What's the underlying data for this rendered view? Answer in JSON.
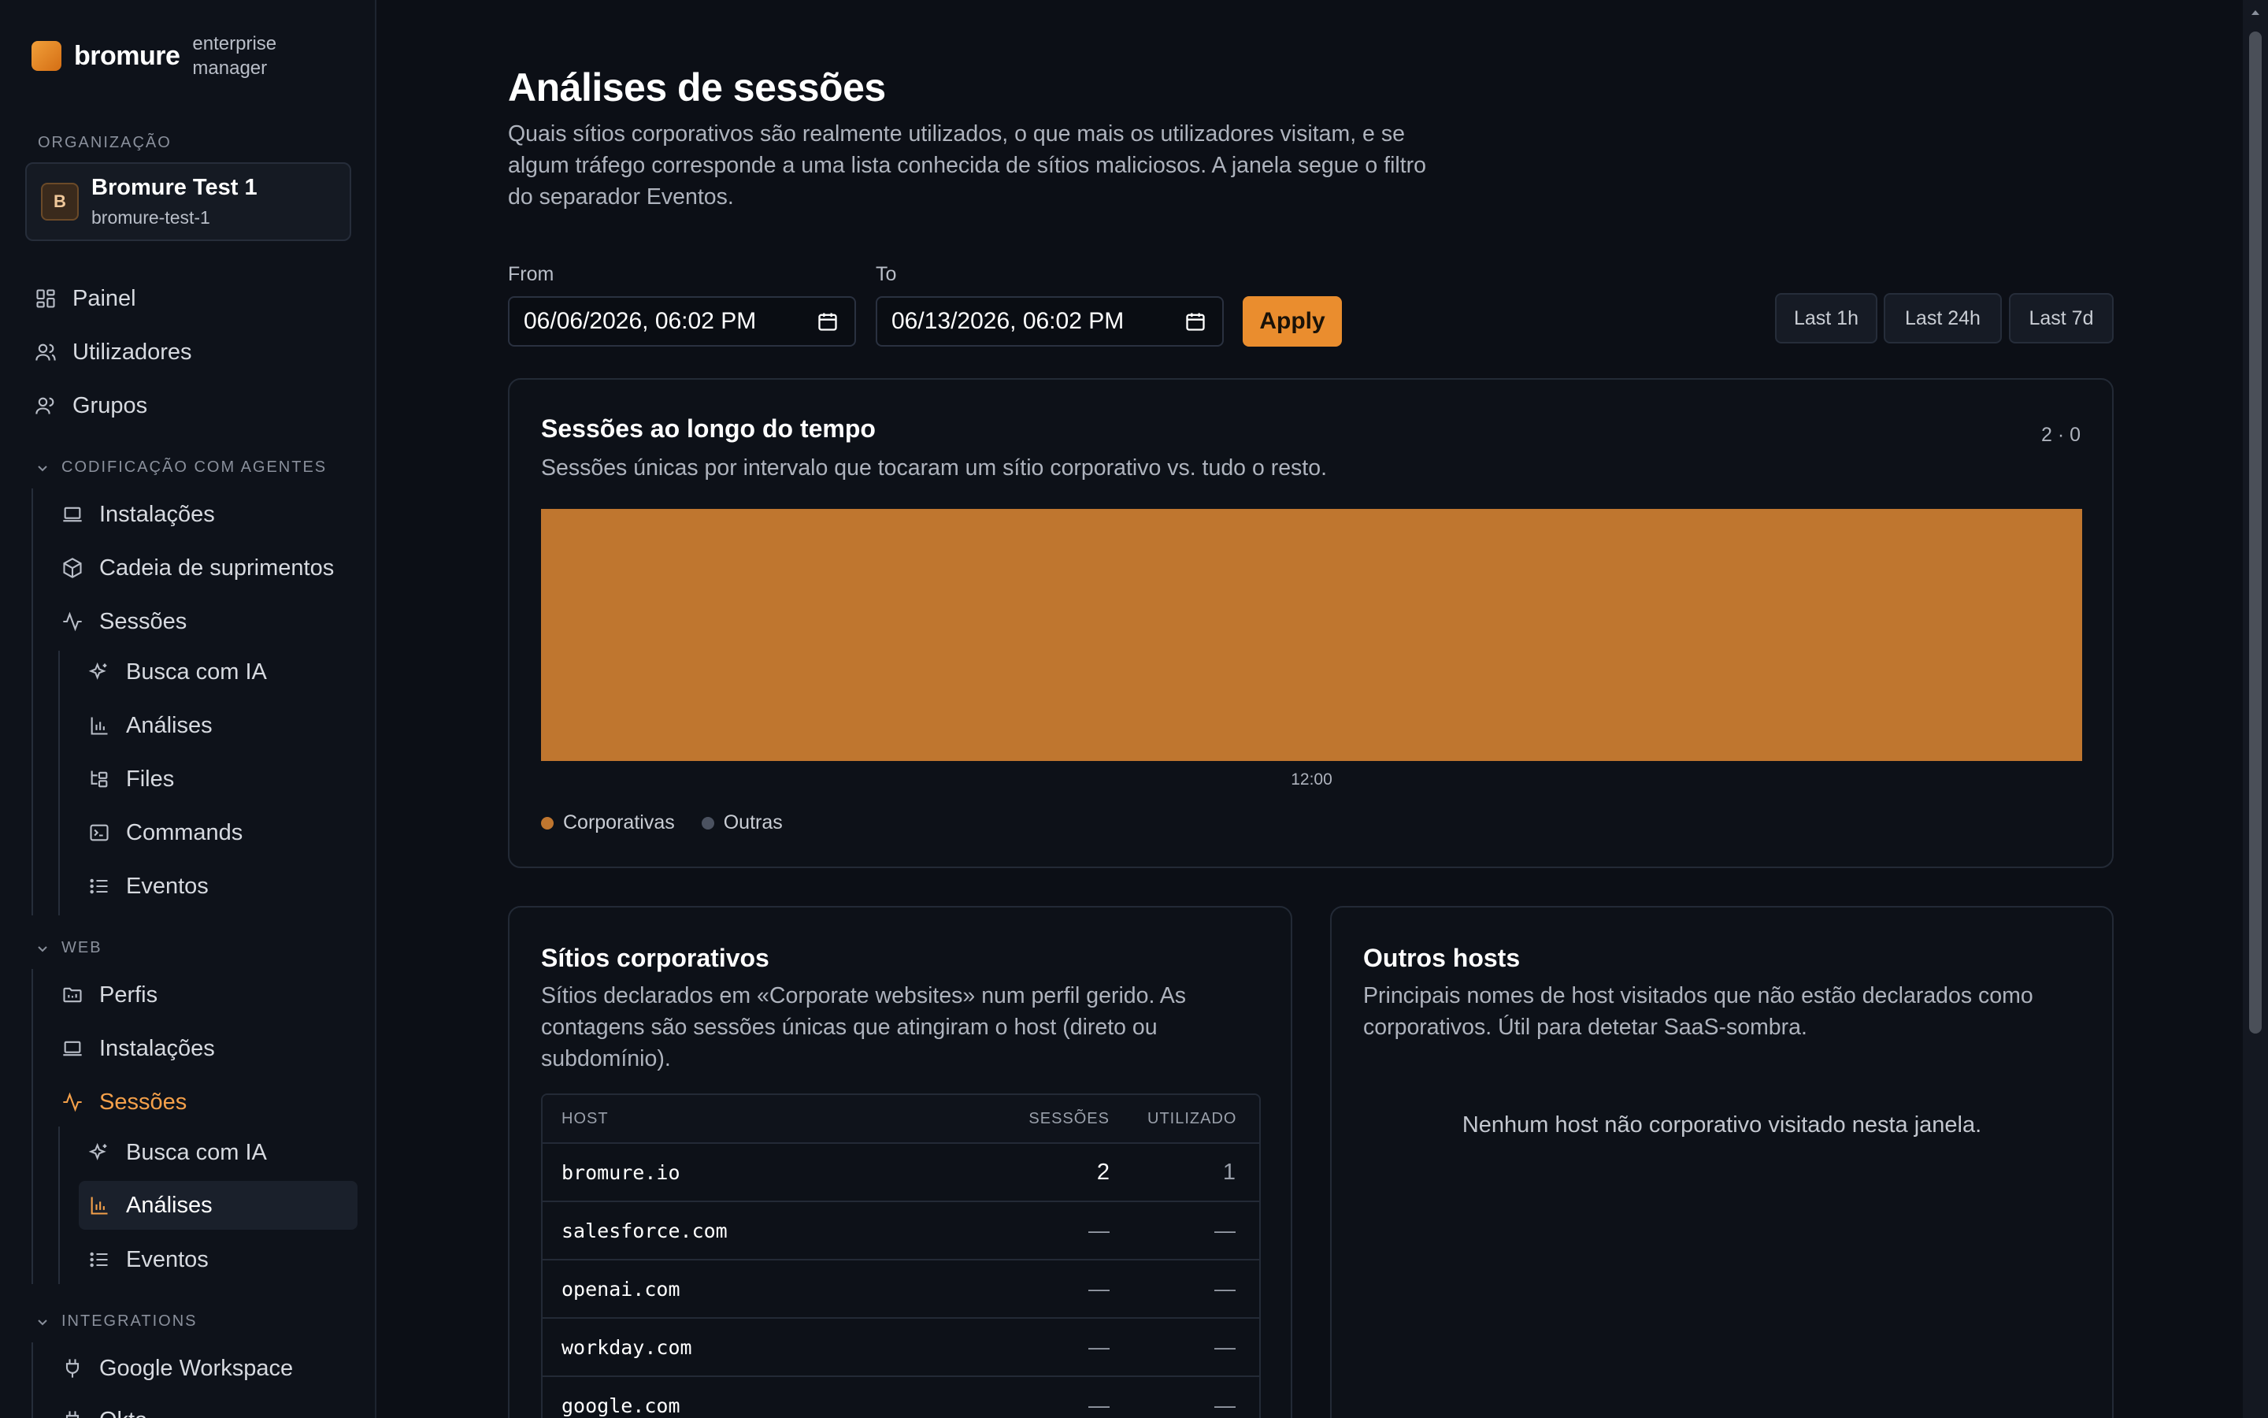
{
  "brand": {
    "name": "bromure",
    "sub": "enterprise manager"
  },
  "org": {
    "section_label": "ORGANIZAÇÃO",
    "name": "Bromure Test 1",
    "slug": "bromure-test-1",
    "avatar_letter": "B"
  },
  "nav": {
    "top": [
      {
        "label": "Painel",
        "icon": "dashboard-icon"
      },
      {
        "label": "Utilizadores",
        "icon": "users-icon"
      },
      {
        "label": "Grupos",
        "icon": "groups-icon"
      }
    ],
    "agents_section": "CODIFICAÇÃO COM AGENTES",
    "agents": {
      "installs": "Instalações",
      "supply_chain": "Cadeia de suprimentos",
      "sessions": "Sessões",
      "sessions_children": [
        "Busca com IA",
        "Análises",
        "Files",
        "Commands",
        "Eventos"
      ]
    },
    "web_section": "WEB",
    "web": {
      "profiles": "Perfis",
      "installs": "Instalações",
      "sessions": "Sessões",
      "sessions_children": [
        "Busca com IA",
        "Análises",
        "Eventos"
      ]
    },
    "integrations_section": "INTEGRATIONS",
    "integrations": {
      "google": "Google Workspace",
      "next": "Okta"
    }
  },
  "page": {
    "title": "Análises de sessões",
    "description": "Quais sítios corporativos são realmente utilizados, o que mais os utilizadores visitam, e se algum tráfego corresponde a uma lista conhecida de sítios maliciosos. A janela segue o filtro do separador Eventos."
  },
  "filters": {
    "from_label": "From",
    "from_value": "06/06/2026, 06:02 PM",
    "to_label": "To",
    "to_value": "06/13/2026, 06:02 PM",
    "apply": "Apply",
    "ranges": [
      "Last 1h",
      "Last 24h",
      "Last 7d"
    ]
  },
  "sessions_card": {
    "title": "Sessões ao longo do tempo",
    "description": "Sessões únicas por intervalo que tocaram um sítio corporativo vs. tudo o resto.",
    "counts": "2 · 0",
    "legend": {
      "corporate": "Corporativas",
      "other": "Outras"
    },
    "colors": {
      "corporate": "#bf762f",
      "other": "#4b5260"
    }
  },
  "chart_data": {
    "type": "bar",
    "categories": [
      "12:00"
    ],
    "series": [
      {
        "name": "Corporativas",
        "values": [
          2
        ]
      },
      {
        "name": "Outras",
        "values": [
          0
        ]
      }
    ],
    "stacked": true,
    "grid": false,
    "legend_position": "bottom-left"
  },
  "corporate_sites": {
    "title": "Sítios corporativos",
    "description": "Sítios declarados em «Corporate websites» num perfil gerido. As contagens são sessões únicas que atingiram o host (direto ou subdomínio).",
    "columns": [
      "HOST",
      "SESSÕES",
      "UTILIZADO"
    ],
    "rows": [
      {
        "host": "bromure.io",
        "sessions": "2",
        "users": "1"
      },
      {
        "host": "salesforce.com",
        "sessions": "—",
        "users": "—"
      },
      {
        "host": "openai.com",
        "sessions": "—",
        "users": "—"
      },
      {
        "host": "workday.com",
        "sessions": "—",
        "users": "—"
      },
      {
        "host": "google.com",
        "sessions": "—",
        "users": "—"
      }
    ]
  },
  "other_hosts": {
    "title": "Outros hosts",
    "description": "Principais nomes de host visitados que não estão declarados como corporativos. Útil para detetar SaaS-sombra.",
    "empty": "Nenhum host não corporativo visitado nesta janela."
  }
}
